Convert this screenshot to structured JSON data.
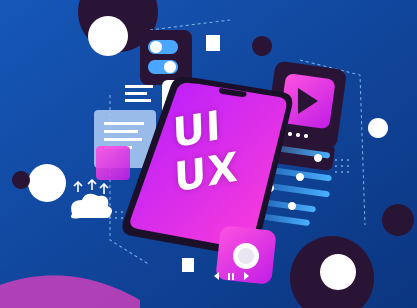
{
  "illustration": {
    "phone_screen_text_line1": "UI",
    "phone_screen_text_line2": "UX"
  },
  "colors": {
    "background": "#0d3f8f",
    "phone_gradient_start": "#b51cff",
    "phone_gradient_end": "#ff3fd6",
    "card_dark": "#2a1436",
    "card_blue": "#4aa6ff",
    "accent_magenta": "#f132c8",
    "bubble_white": "#ffffff"
  },
  "icons": [
    "toggle-switch-icon",
    "hidden-eye-icon",
    "play-icon",
    "document-icon",
    "cloud-upload-icon",
    "slider-lines-icon",
    "round-button-icon"
  ]
}
